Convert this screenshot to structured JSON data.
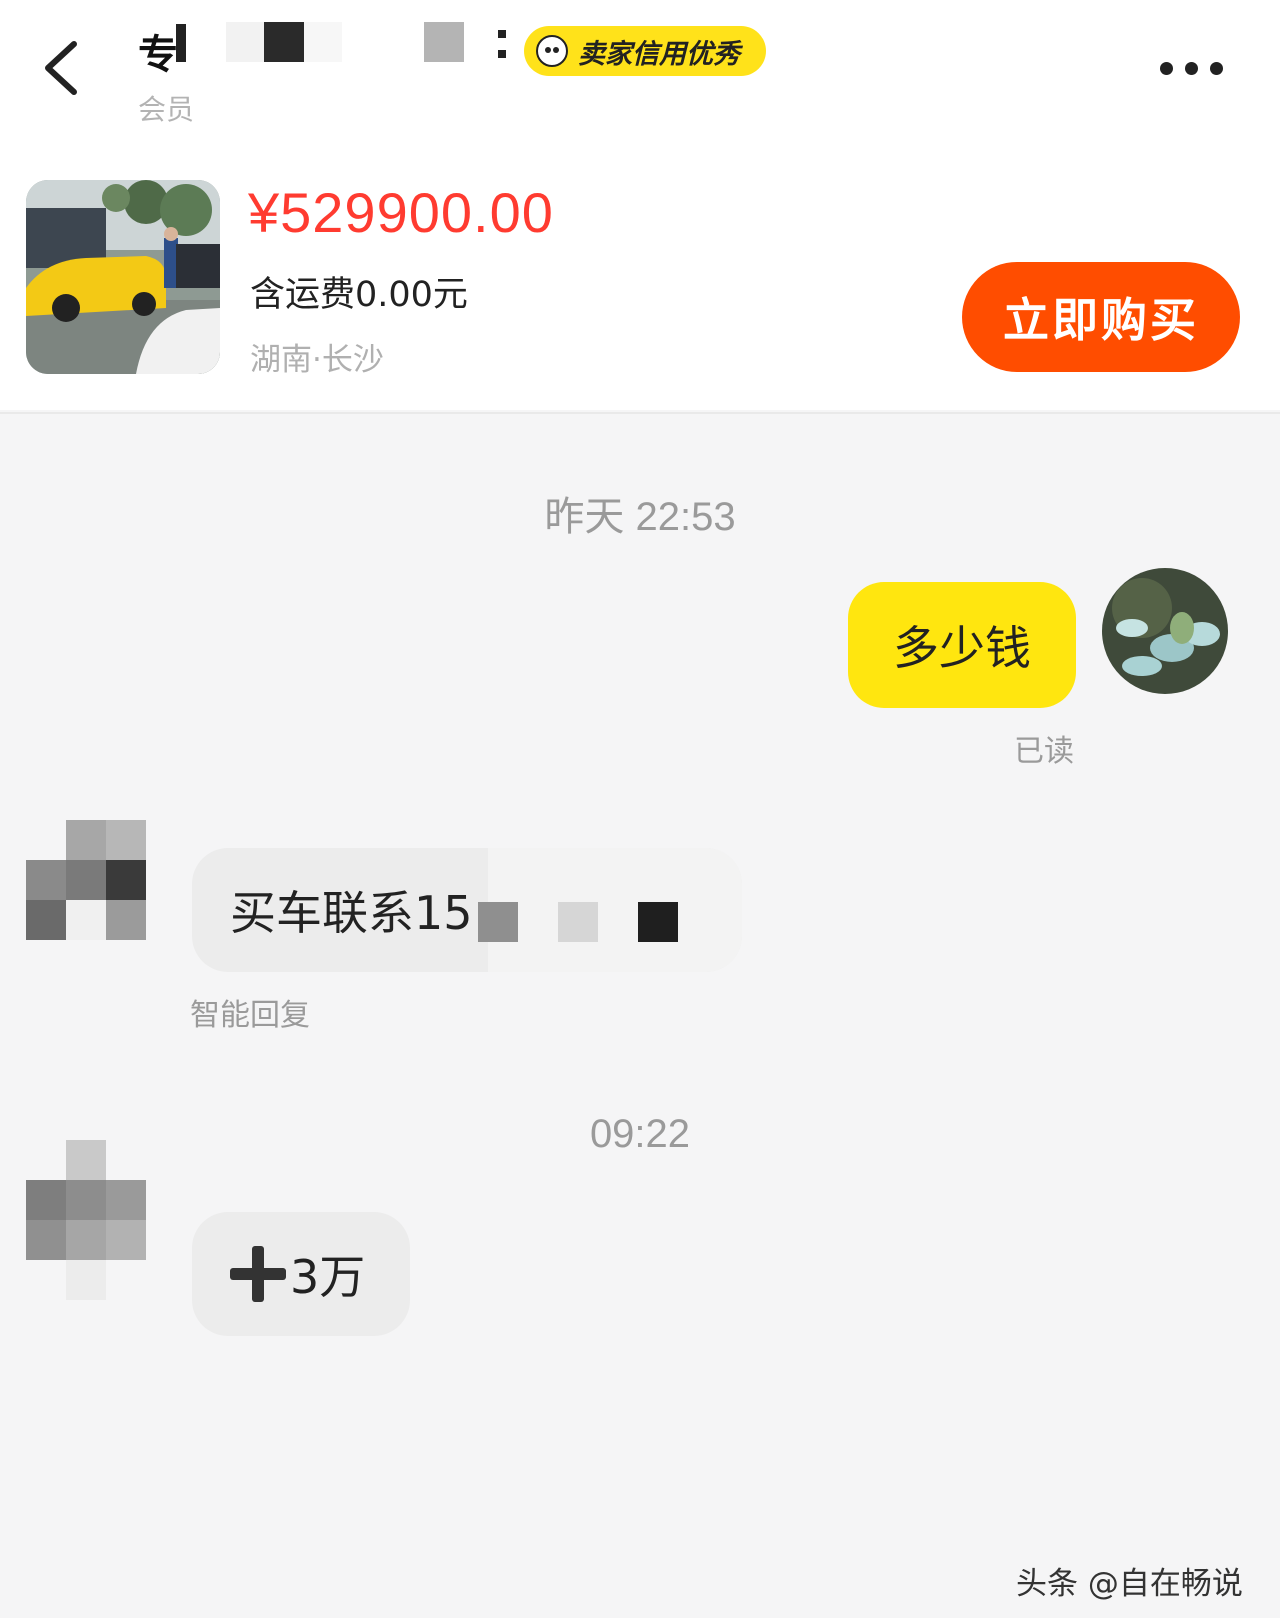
{
  "header": {
    "back_icon": "chevron-left-icon",
    "seller_name": "专",
    "seller_subtitle": "会员",
    "credit_badge": "卖家信用优秀",
    "more_icon": "more-dots-icon"
  },
  "product": {
    "price": "¥529900.00",
    "shipping": "含运费0.00元",
    "location": "湖南·长沙",
    "buy_label": "立即购买"
  },
  "chat": {
    "timestamp_1": "昨天 22:53",
    "my_message": "多少钱",
    "read_status": "已读",
    "seller_message_1": "买车联系15",
    "auto_reply_label": "智能回复",
    "timestamp_2": "09:22",
    "seller_message_2": "3万"
  },
  "watermark": "头条 @自在畅说",
  "colors": {
    "price": "#ff3b30",
    "buy_button": "#ff4d00",
    "my_bubble": "#ffe60f",
    "credit_badge": "#ffe21a",
    "background": "#f5f5f6"
  }
}
